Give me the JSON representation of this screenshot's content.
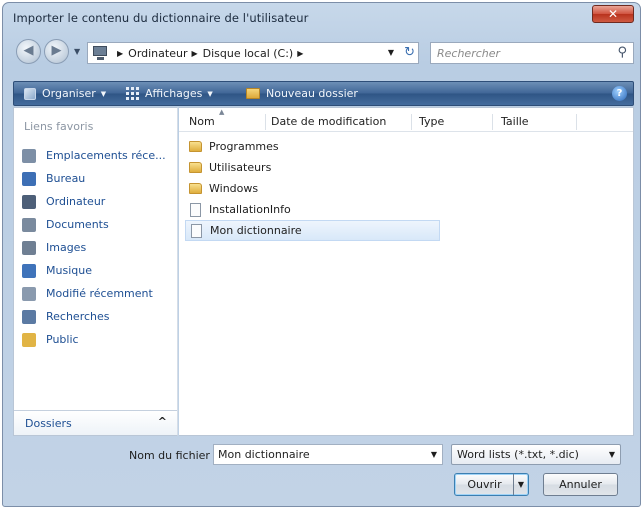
{
  "window": {
    "title": "Importer le contenu du dictionnaire de l'utilisateur"
  },
  "address": {
    "breadcrumbs": [
      "Ordinateur",
      "Disque local (C:)"
    ],
    "search_placeholder": "Rechercher"
  },
  "toolbar": {
    "organise": "Organiser",
    "views": "Affichages",
    "new_folder": "Nouveau dossier",
    "help": "?"
  },
  "sidebar": {
    "section_title": "Liens favoris",
    "items": [
      {
        "label": "Emplacements réce...",
        "icon": "recent-places-icon",
        "color": "#7d8fa6"
      },
      {
        "label": "Bureau",
        "icon": "desktop-icon",
        "color": "#3d6fb5"
      },
      {
        "label": "Ordinateur",
        "icon": "computer-icon",
        "color": "#4d5f78"
      },
      {
        "label": "Documents",
        "icon": "documents-icon",
        "color": "#7a8a9e"
      },
      {
        "label": "Images",
        "icon": "pictures-icon",
        "color": "#6f7f93"
      },
      {
        "label": "Musique",
        "icon": "music-icon",
        "color": "#3f73ba"
      },
      {
        "label": "Modifié récemment",
        "icon": "recently-changed-icon",
        "color": "#8a9aae"
      },
      {
        "label": "Recherches",
        "icon": "searches-icon",
        "color": "#5b7aa3"
      },
      {
        "label": "Public",
        "icon": "public-folder-icon",
        "color": "#e1b445"
      }
    ],
    "folders_label": "Dossiers",
    "folders_caret": "^"
  },
  "filelist": {
    "columns": [
      "Nom",
      "Date de modification",
      "Type",
      "Taille"
    ],
    "rows": [
      {
        "name": "Programmes",
        "kind": "folder"
      },
      {
        "name": "Utilisateurs",
        "kind": "folder"
      },
      {
        "name": "Windows",
        "kind": "folder"
      },
      {
        "name": "InstallationInfo",
        "kind": "file"
      },
      {
        "name": "Mon dictionnaire",
        "kind": "file",
        "selected": true
      }
    ]
  },
  "footer": {
    "filename_label": "Nom du fichier :",
    "filename_value": "Mon dictionnaire",
    "filetype_value": "Word lists (*.txt, *.dic)",
    "open_button": "Ouvrir",
    "cancel_button": "Annuler"
  }
}
